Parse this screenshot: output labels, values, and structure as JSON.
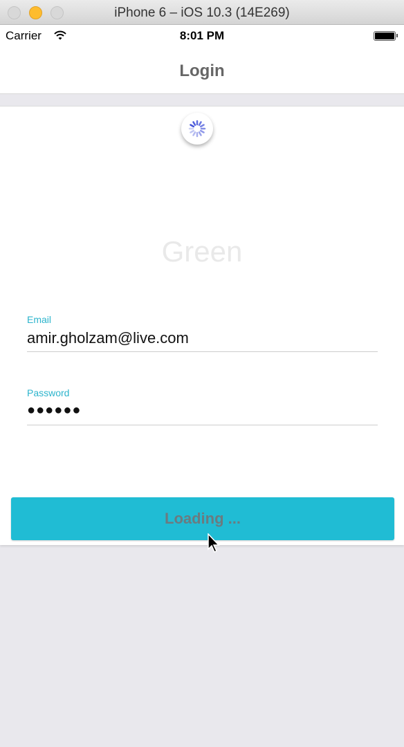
{
  "window": {
    "title": "iPhone 6 – iOS 10.3 (14E269)"
  },
  "status_bar": {
    "carrier": "Carrier",
    "time": "8:01 PM"
  },
  "nav": {
    "title": "Login"
  },
  "logo": {
    "text": "Green"
  },
  "form": {
    "email": {
      "label": "Email",
      "value": "amir.gholzam@live.com"
    },
    "password": {
      "label": "Password",
      "value": "●●●●●●"
    }
  },
  "button": {
    "label": "Loading ..."
  },
  "colors": {
    "accent": "#20bcd4",
    "label": "#2cb4cc",
    "spinner": "#3a4bd8"
  }
}
